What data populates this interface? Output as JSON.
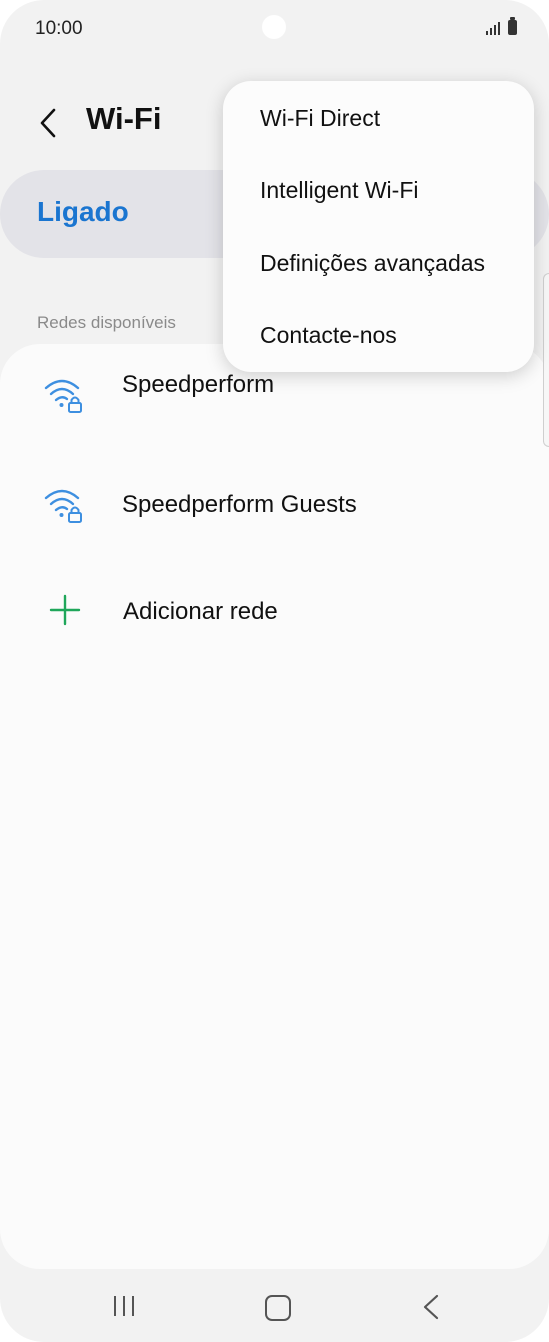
{
  "status_bar": {
    "time": "10:00"
  },
  "header": {
    "title": "Wi-Fi"
  },
  "master_switch": {
    "label": "Ligado",
    "state": "on"
  },
  "networks": {
    "section_title": "Redes disponíveis",
    "items": [
      {
        "name": "Speedperform",
        "icon": "wifi-locked-icon"
      },
      {
        "name": "Speedperform Guests",
        "icon": "wifi-locked-icon"
      }
    ],
    "add_network_label": "Adicionar rede"
  },
  "menu": {
    "items": [
      {
        "label": "Wi-Fi Direct"
      },
      {
        "label": "Intelligent Wi-Fi"
      },
      {
        "label": "Definições avançadas"
      },
      {
        "label": "Contacte-nos"
      }
    ]
  },
  "colors": {
    "accent": "#1a75d0",
    "wifi_icon": "#3d8fe0",
    "add_icon": "#1fa65a"
  }
}
